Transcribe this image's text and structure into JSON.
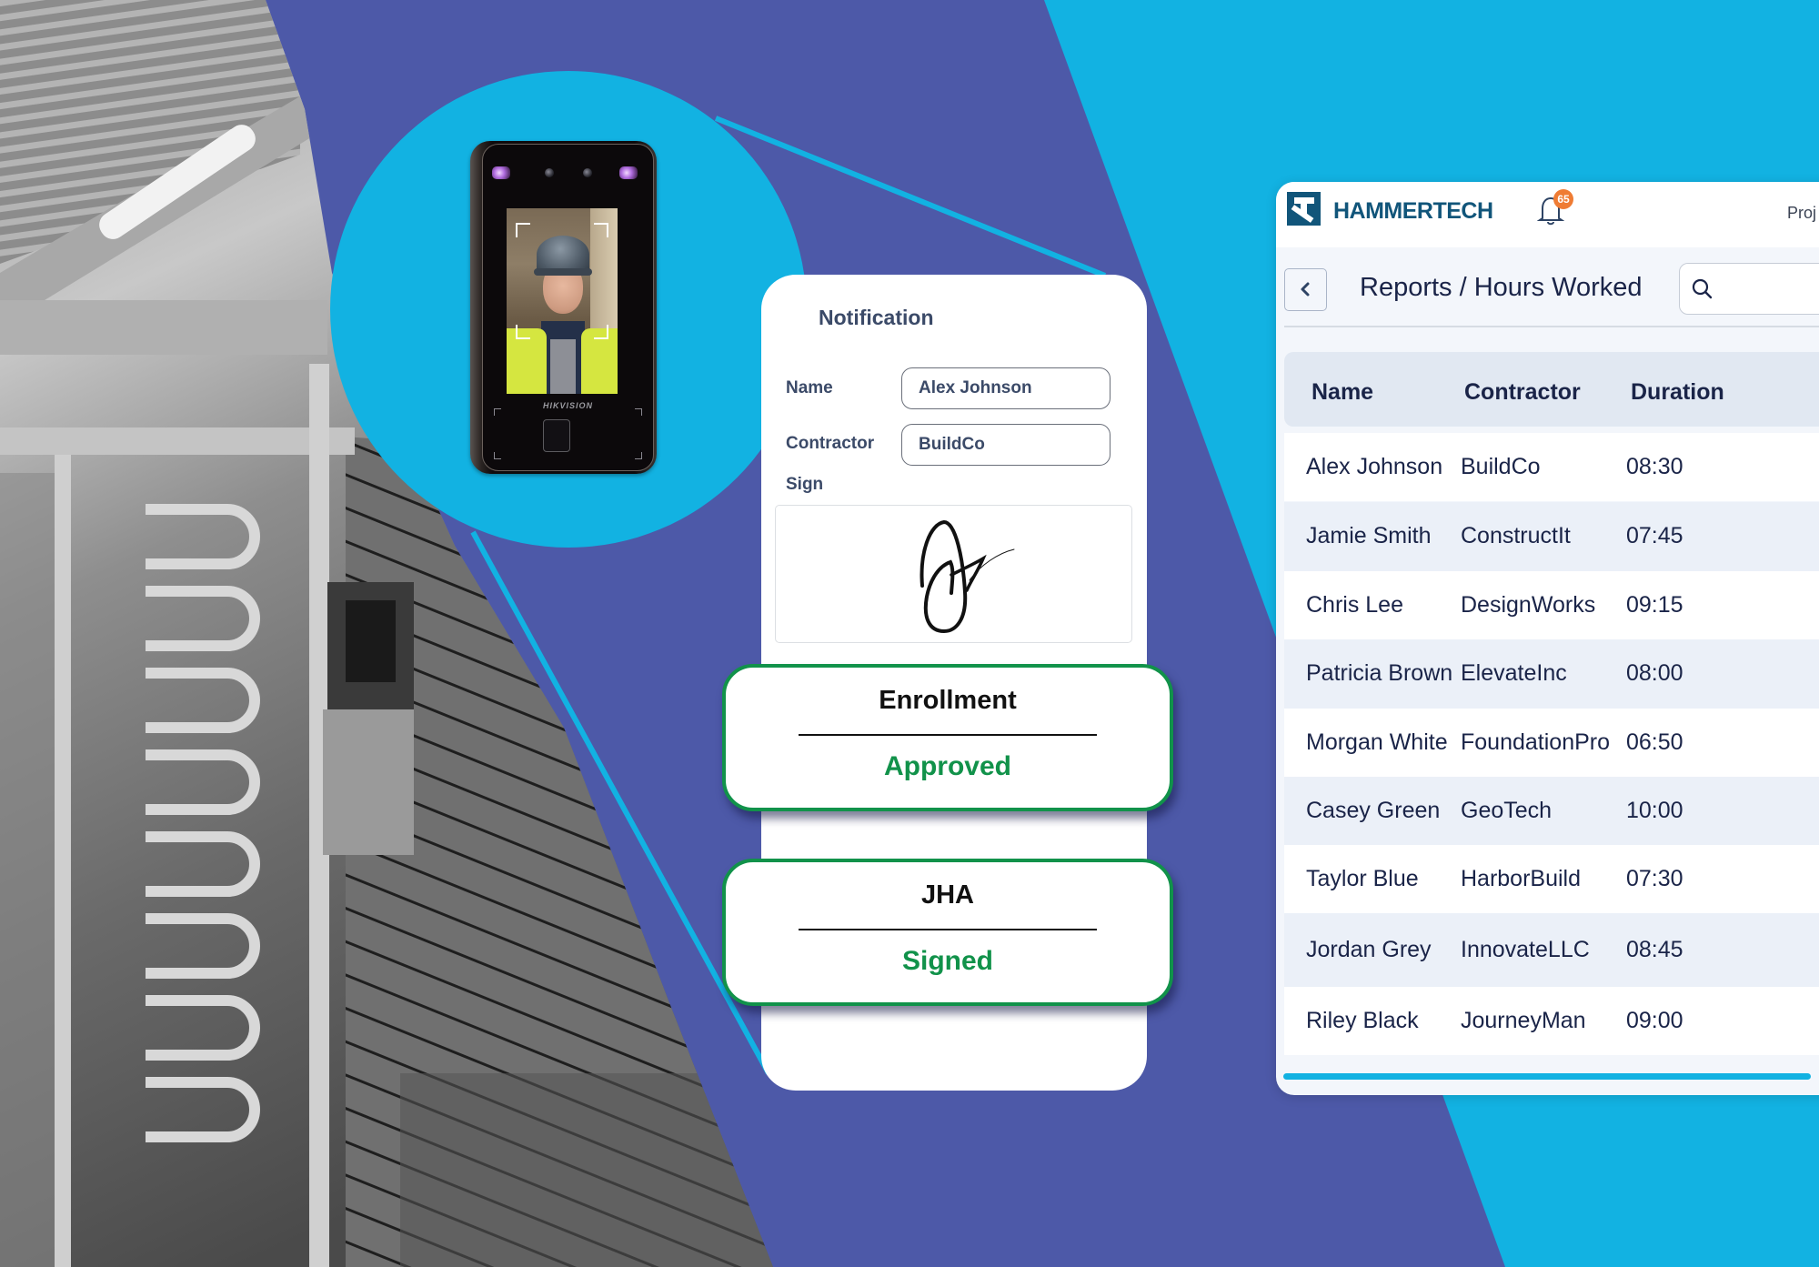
{
  "colors": {
    "purple_bg": "#4d59a8",
    "cyan_accent": "#12b2e2",
    "success_green": "#11924a",
    "brand_blue": "#11557a",
    "badge_orange": "#ef7c34",
    "text_navy": "#1a2448"
  },
  "device": {
    "brand": "HIKVISION",
    "icon": "face-recognition-terminal-icon"
  },
  "notification_form": {
    "title": "Notification",
    "fields": [
      {
        "label": "Name",
        "value": "Alex Johnson"
      },
      {
        "label": "Contractor",
        "value": "BuildCo"
      }
    ],
    "sign_label": "Sign",
    "signature_icon": "signature-icon"
  },
  "status_cards": [
    {
      "title": "Enrollment",
      "value": "Approved"
    },
    {
      "title": "JHA",
      "value": "Signed"
    }
  ],
  "dashboard": {
    "brand": "HAMMERTECH",
    "logo_icon": "hammertech-logo-icon",
    "notifications_count": "65",
    "bell_icon": "bell-icon",
    "nav_link_partial": "Proj",
    "back_icon": "chevron-left-icon",
    "page_title": "Reports / Hours Worked",
    "search_icon": "search-icon",
    "search_placeholder": "",
    "table": {
      "columns": [
        "Name",
        "Contractor",
        "Duration"
      ],
      "rows": [
        [
          "Alex Johnson",
          "BuildCo",
          "08:30"
        ],
        [
          "Jamie Smith",
          "ConstructIt",
          "07:45"
        ],
        [
          "Chris Lee",
          "DesignWorks",
          "09:15"
        ],
        [
          "Patricia Brown",
          "ElevateInc",
          "08:00"
        ],
        [
          "Morgan White",
          "FoundationPro",
          "06:50"
        ],
        [
          "Casey Green",
          "GeoTech",
          "10:00"
        ],
        [
          "Taylor Blue",
          "HarborBuild",
          "07:30"
        ],
        [
          "Jordan Grey",
          "InnovateLLC",
          "08:45"
        ],
        [
          "Riley Black",
          "JourneyMan",
          "09:00"
        ]
      ]
    },
    "scroll_progress_fraction": 1.0
  }
}
